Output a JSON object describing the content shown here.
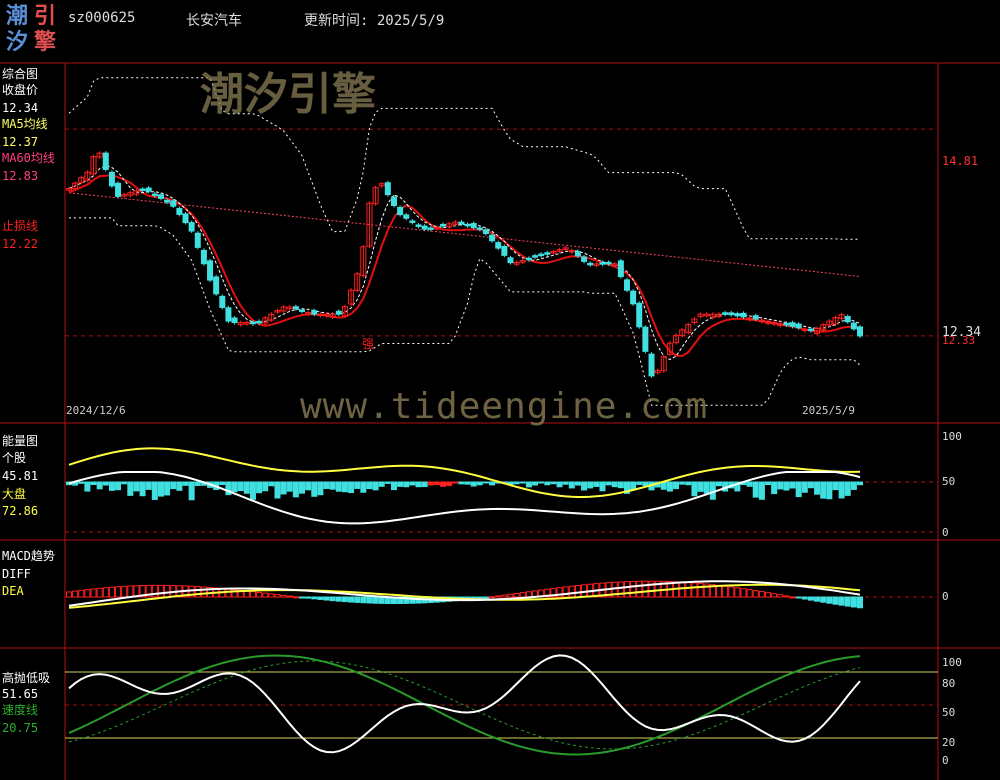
{
  "logo": {
    "chars": [
      "潮",
      "引",
      "汐",
      "擎"
    ],
    "colors": [
      "#5b8fd8",
      "#e05050",
      "#5b8fd8",
      "#e05050"
    ]
  },
  "header": {
    "code": "sz000625",
    "name": "长安汽车",
    "update_label": "更新时间:",
    "update_date": "2025/5/9"
  },
  "watermark": {
    "top": "潮汐引擎",
    "url": "www.tideengine.com"
  },
  "panels": {
    "main": {
      "title": "综合图",
      "close_label": "收盘价",
      "close_value": "12.34",
      "ma5_label": "MA5均线",
      "ma5_value": "12.37",
      "ma60_label": "MA60均线",
      "ma60_value": "12.83",
      "stop_label": "止损线",
      "stop_value": "12.22",
      "strong_label": "强",
      "date_start": "2024/12/6",
      "date_end": "2025/5/9",
      "axis_hi": "14.81",
      "axis_lo": "12.34",
      "axis_lo2": "12.33"
    },
    "energy": {
      "title": "能量图",
      "stock_label": "个股",
      "stock_value": "45.81",
      "market_label": "大盘",
      "market_value": "72.86",
      "ticks": [
        "100",
        "50",
        "0"
      ]
    },
    "macd": {
      "title": "MACD趋势",
      "diff_label": "DIFF",
      "dea_label": "DEA",
      "ticks": [
        "0"
      ]
    },
    "hilo": {
      "title": "高抛低吸",
      "value": "51.65",
      "speed_label": "速度线",
      "speed_value": "20.75",
      "ticks": [
        "100",
        "80",
        "50",
        "20",
        "0"
      ]
    }
  },
  "colors": {
    "up": "#ff2020",
    "down": "#40e0e0",
    "ma5": "#ffffff",
    "ma60": "#ff4060",
    "stop": "#e01010",
    "band": "#ffffff",
    "yellow": "#ffff40",
    "green": "#2a9a2a",
    "grid": "#b01010",
    "ma5label": "#ffff60",
    "ma60label": "#ff4080"
  },
  "chart_data": [
    {
      "type": "candlestick",
      "title": "综合图",
      "series_names": [
        "收盘价",
        "MA5均线",
        "MA60均线",
        "止损线"
      ],
      "x": [
        "2024/12/6",
        "2025/5/9"
      ],
      "ylim": [
        11.3,
        15.6
      ],
      "n": 130,
      "close_keyframes": [
        [
          0,
          14.1
        ],
        [
          4,
          14.3
        ],
        [
          6,
          14.6
        ],
        [
          10,
          14.0
        ],
        [
          16,
          14.1
        ],
        [
          22,
          13.9
        ],
        [
          26,
          13.6
        ],
        [
          30,
          13.0
        ],
        [
          34,
          12.5
        ],
        [
          40,
          12.5
        ],
        [
          46,
          12.7
        ],
        [
          52,
          12.6
        ],
        [
          58,
          12.6
        ],
        [
          62,
          13.2
        ],
        [
          64,
          14.0
        ],
        [
          66,
          14.2
        ],
        [
          70,
          13.8
        ],
        [
          76,
          13.6
        ],
        [
          82,
          13.7
        ],
        [
          88,
          13.6
        ],
        [
          94,
          13.2
        ],
        [
          100,
          13.3
        ],
        [
          106,
          13.4
        ],
        [
          110,
          13.2
        ],
        [
          116,
          13.2
        ],
        [
          120,
          12.7
        ],
        [
          124,
          11.8
        ],
        [
          128,
          12.3
        ],
        [
          134,
          12.6
        ],
        [
          140,
          12.6
        ],
        [
          150,
          12.5
        ],
        [
          158,
          12.4
        ],
        [
          164,
          12.6
        ],
        [
          168,
          12.34
        ]
      ],
      "last_close": 12.34
    },
    {
      "type": "bar+line",
      "title": "能量图",
      "ylim": [
        0,
        100
      ],
      "series": [
        "个股",
        "大盘"
      ],
      "last": [
        45.81,
        72.86
      ]
    },
    {
      "type": "bar+line",
      "title": "MACD趋势",
      "series": [
        "DIFF",
        "DEA"
      ]
    },
    {
      "type": "line",
      "title": "高抛低吸",
      "ylim": [
        0,
        100
      ],
      "series": [
        "高抛低吸",
        "速度线"
      ],
      "last": [
        51.65,
        20.75
      ]
    }
  ]
}
